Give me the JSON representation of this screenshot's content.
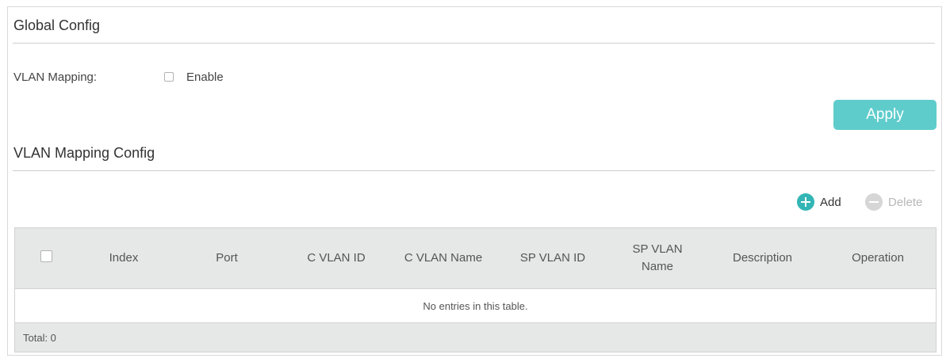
{
  "global_config": {
    "title": "Global Config",
    "vlan_mapping_label": "VLAN Mapping:",
    "enable_label": "Enable",
    "enable_checked": false,
    "apply_label": "Apply"
  },
  "mapping_config": {
    "title": "VLAN Mapping Config",
    "add_label": "Add",
    "delete_label": "Delete",
    "table": {
      "columns": [
        "Index",
        "Port",
        "C VLAN ID",
        "C VLAN Name",
        "SP VLAN ID",
        "SP VLAN Name",
        "Description",
        "Operation"
      ],
      "column_lines": {
        "sp_vlan_name_line1": "SP VLAN",
        "sp_vlan_name_line2": "Name"
      },
      "empty_text": "No entries in this table.",
      "total_label": "Total: 0"
    }
  },
  "colors": {
    "accent": "#33b5b5",
    "apply_button": "#5fcccc",
    "header_bg": "#e5e8e7"
  }
}
